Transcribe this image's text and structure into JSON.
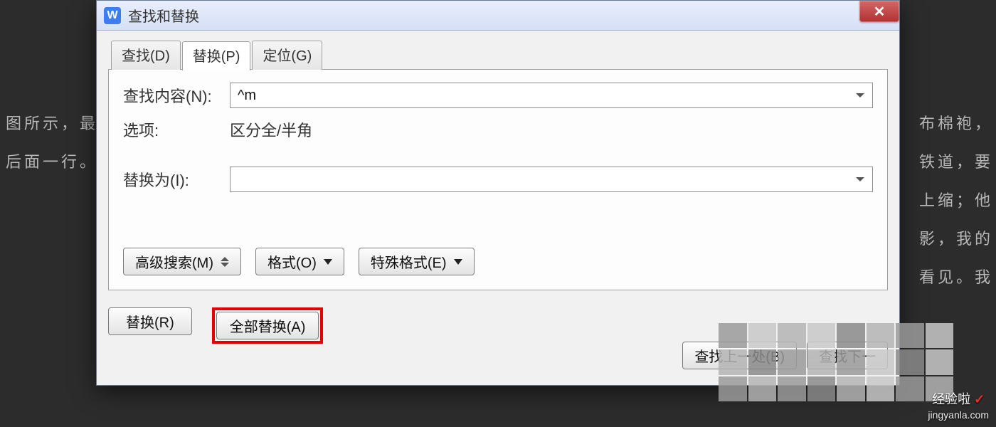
{
  "bg": {
    "line1": "图所示，最",
    "line2": "后面一行。",
    "r1": "布棉袍，",
    "r2": "铁道，要",
    "r3": "上缩；他",
    "r4": "影，我的",
    "r5": "看见。我"
  },
  "title": "查找和替换",
  "tabs": {
    "find": "查找(D)",
    "replace": "替换(P)",
    "goto": "定位(G)"
  },
  "labels": {
    "find_what": "查找内容(N):",
    "options": "选项:",
    "replace_with": "替换为(I):"
  },
  "values": {
    "find_what": "^m",
    "options": "区分全/半角",
    "replace_with": ""
  },
  "buttons": {
    "advanced": "高级搜索(M)",
    "format": "格式(O)",
    "special": "特殊格式(E)",
    "replace": "替换(R)",
    "replace_all": "全部替换(A)",
    "find_prev": "查找上一处(B)",
    "find_next": "查找下一"
  },
  "watermark": {
    "name": "经验啦",
    "check": "✓",
    "url": "jingyanla.com"
  }
}
